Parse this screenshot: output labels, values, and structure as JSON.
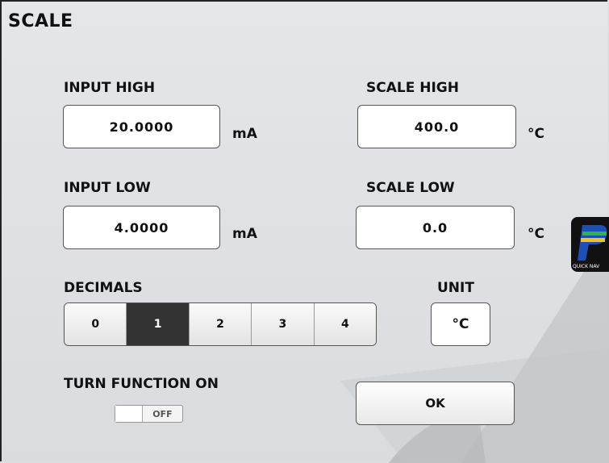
{
  "title": "SCALE",
  "input_high": {
    "label": "INPUT HIGH",
    "value": "20.0000",
    "unit": "mA"
  },
  "input_low": {
    "label": "INPUT LOW",
    "value": "4.0000",
    "unit": "mA"
  },
  "scale_high": {
    "label": "SCALE HIGH",
    "value": "400.0",
    "unit": "°C"
  },
  "scale_low": {
    "label": "SCALE LOW",
    "value": "0.0",
    "unit": "°C"
  },
  "decimals": {
    "label": "DECIMALS",
    "options": [
      "0",
      "1",
      "2",
      "3",
      "4"
    ],
    "selected": "1"
  },
  "unit": {
    "label": "UNIT",
    "value": "°C"
  },
  "turn_function": {
    "label": "TURN FUNCTION ON",
    "state": "OFF"
  },
  "ok_label": "OK",
  "quick_nav": {
    "label": "QUICK NAV",
    "icon": "quick-nav-logo-icon"
  }
}
